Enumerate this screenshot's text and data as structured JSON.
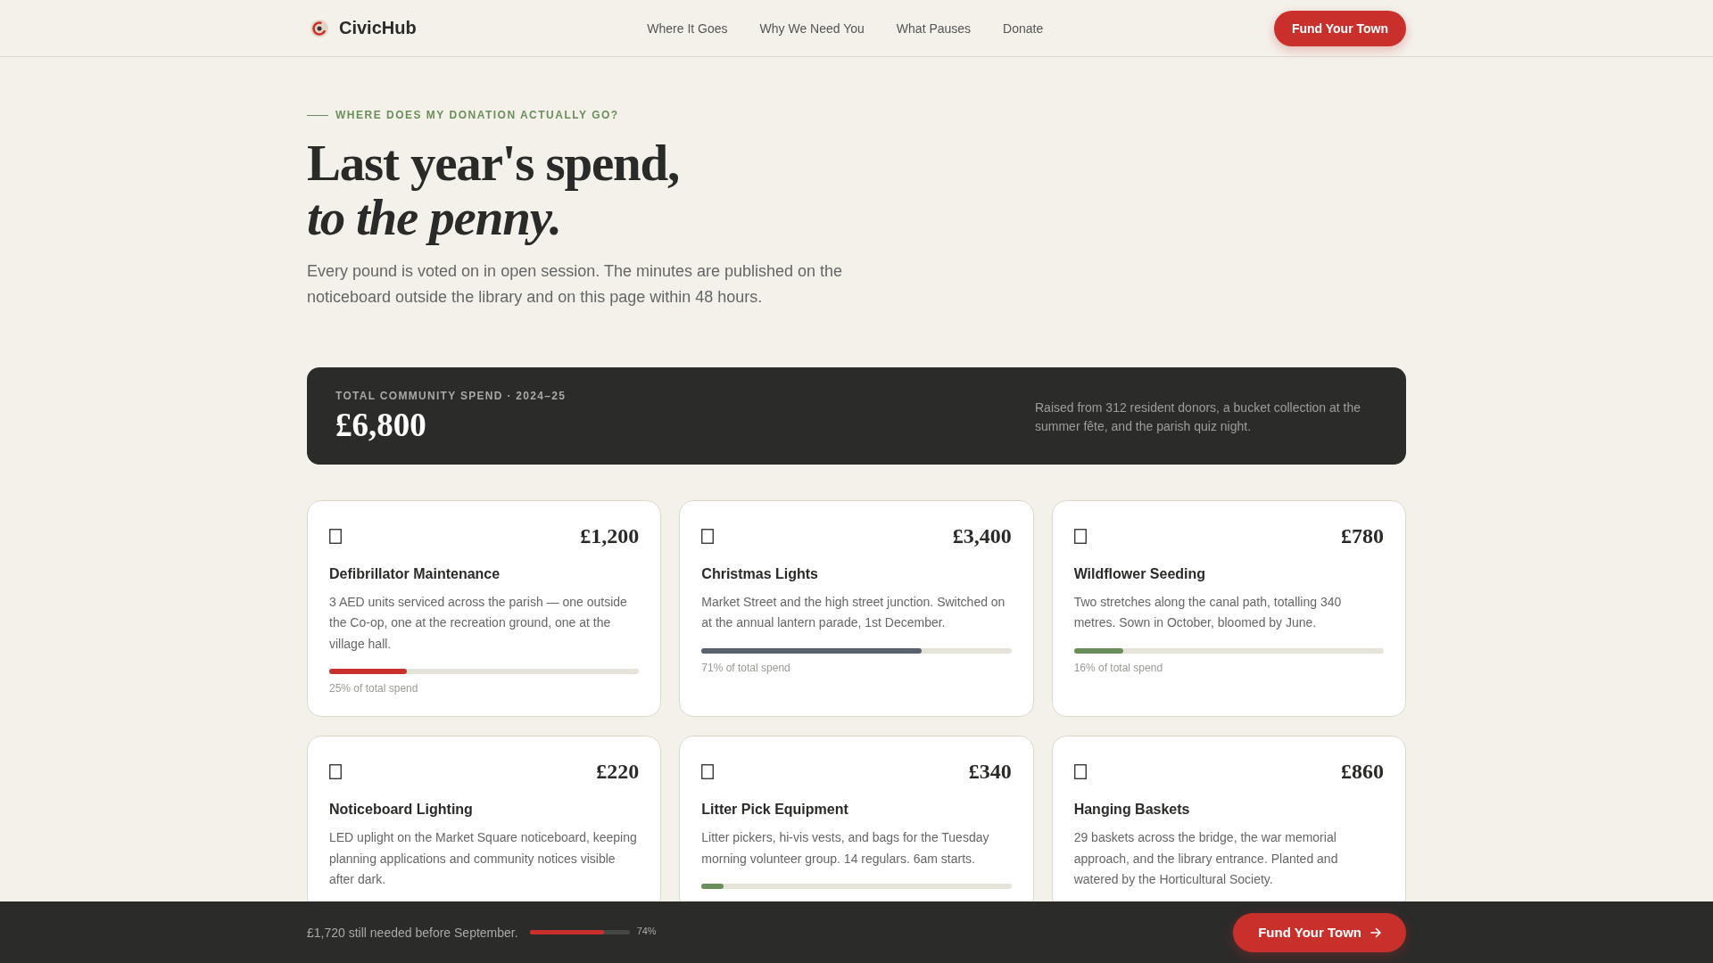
{
  "header": {
    "brand": "CivicHub",
    "nav": [
      "Where It Goes",
      "Why We Need You",
      "What Pauses",
      "Donate"
    ],
    "cta": "Fund Your Town"
  },
  "hero": {
    "eyebrow": "WHERE DOES MY DONATION ACTUALLY GO?",
    "title_line_1": "Last year's spend,",
    "title_line_2": "to the penny.",
    "intro": "Every pound is voted on in open session. The minutes are published on the noticeboard outside the library and on this page within 48 hours."
  },
  "summary": {
    "label": "TOTAL COMMUNITY SPEND · 2024–25",
    "total": "£6,800",
    "note": "Raised from 312 resident donors, a bucket collection at the summer fête, and the parish quiz night."
  },
  "cards": [
    {
      "amount": "£1,200",
      "title": "Defibrillator Maintenance",
      "description": "3 AED units serviced across the parish — one outside the Co-op, one at the recreation ground, one at the village hall.",
      "level": 0.25,
      "color": "#c8302c",
      "share": "25% of total spend"
    },
    {
      "amount": "£3,400",
      "title": "Christmas Lights",
      "description": "Market Street and the high street junction. Switched on at the annual lantern parade, 1st December.",
      "level": 0.71,
      "color": "#5a636d",
      "share": "71% of total spend"
    },
    {
      "amount": "£780",
      "title": "Wildflower Seeding",
      "description": "Two stretches along the canal path, totalling 340 metres. Sown in October, bloomed by June.",
      "level": 0.16,
      "color": "#6a8f5a",
      "share": "16% of total spend"
    },
    {
      "amount": "£220",
      "title": "Noticeboard Lighting",
      "description": "LED uplight on the Market Square noticeboard, keeping planning applications and community notices visible after dark."
    },
    {
      "amount": "£340",
      "title": "Litter Pick Equipment",
      "description": "Litter pickers, hi-vis vests, and bags for the Tuesday morning volunteer group. 14 regulars. 6am starts.",
      "level": 0.07,
      "color": "#6a8f5a"
    },
    {
      "amount": "£860",
      "title": "Hanging Baskets",
      "description": "29 baskets across the bridge, the war memorial approach, and the library entrance. Planted and watered by the Horticultural Society."
    }
  ],
  "footer_bar": {
    "message": "£1,720 still needed before September.",
    "level": 0.74,
    "percent": "74%",
    "cta": "Fund Your Town"
  }
}
